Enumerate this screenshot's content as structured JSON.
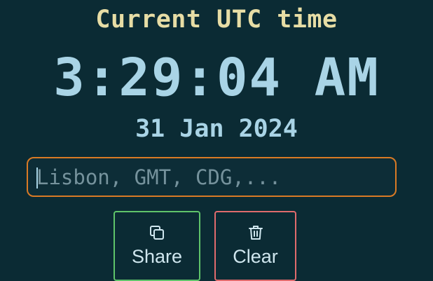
{
  "header": {
    "title": "Current UTC time"
  },
  "clock": {
    "time": "3:29:04 AM",
    "date": "31 Jan 2024"
  },
  "search": {
    "value": "",
    "placeholder": "Lisbon, GMT, CDG,..."
  },
  "actions": {
    "share_label": "Share",
    "share_icon": "copy-icon",
    "clear_label": "Clear",
    "clear_icon": "trash-icon"
  },
  "colors": {
    "background": "#0b2b34",
    "title": "#e7dda5",
    "clock_text": "#a9d4e6",
    "search_border": "#d97a25",
    "share_border": "#5fc46a",
    "clear_border": "#e06b6d"
  }
}
